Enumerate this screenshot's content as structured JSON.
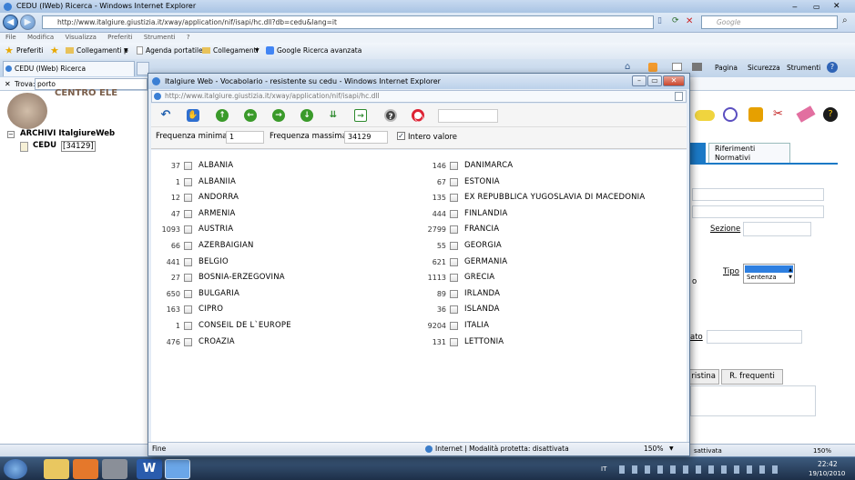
{
  "main_window": {
    "title": "CEDU (IWeb) Ricerca - Windows Internet Explorer",
    "url": "http://www.italgiure.giustizia.it/xway/application/nif/isapi/hc.dll?db=cedu&lang=it",
    "search_placeholder": "Google",
    "menu": [
      "File",
      "Modifica",
      "Visualizza",
      "Preferiti",
      "Strumenti",
      "?"
    ],
    "favorites": {
      "preferiti": "Preferiti",
      "items": [
        "Collegamenti p",
        "Agenda portatile",
        "Collegamenti",
        "Google Ricerca avanzata"
      ]
    },
    "tab_label": "CEDU (IWeb) Ricerca",
    "command_bar": [
      "Pagina",
      "Sicurezza",
      "Strumenti"
    ],
    "find": {
      "label": "Trova:",
      "value": "porto"
    },
    "tree": {
      "root": "ARCHIVI ItalgiureWeb",
      "child": "CEDU",
      "child_count": "[34129]"
    },
    "partial_header_text": "CENTRO ELE",
    "right_panel": {
      "tab_riferimenti": "Riferimenti Normativi",
      "sezione_label": "Sezione",
      "tipo_label": "Tipo",
      "tipo_option": "Sentenza",
      "fragment_o": "o",
      "fragment_ato": "ato",
      "btn_ristina": "ristina",
      "btn_rfrequenti": "R. frequenti"
    },
    "status": {
      "text": "sattivata",
      "zoom": "150%"
    }
  },
  "popup": {
    "title": "Italgiure Web - Vocabolario - resistente su cedu - Windows Internet Explorer",
    "url": "http://www.italgiure.giustizia.it/xway/application/nif/isapi/hc.dll",
    "filter": {
      "freq_min_label": "Frequenza minima",
      "freq_min_value": "1",
      "freq_max_label": "Frequenza massima",
      "freq_max_value": "34129",
      "intero_label": "Intero valore"
    },
    "left_column": [
      {
        "count": "37",
        "term": "ALBANIA"
      },
      {
        "count": "1",
        "term": "ALBANIIA"
      },
      {
        "count": "12",
        "term": "ANDORRA"
      },
      {
        "count": "47",
        "term": "ARMENIA"
      },
      {
        "count": "1093",
        "term": "AUSTRIA"
      },
      {
        "count": "66",
        "term": "AZERBAIGIAN"
      },
      {
        "count": "441",
        "term": "BELGIO"
      },
      {
        "count": "27",
        "term": "BOSNIA-ERZEGOVINA"
      },
      {
        "count": "650",
        "term": "BULGARIA"
      },
      {
        "count": "163",
        "term": "CIPRO"
      },
      {
        "count": "1",
        "term": "CONSEIL DE L`EUROPE"
      },
      {
        "count": "476",
        "term": "CROAZIA"
      }
    ],
    "right_column": [
      {
        "count": "146",
        "term": "DANIMARCA"
      },
      {
        "count": "67",
        "term": "ESTONIA"
      },
      {
        "count": "135",
        "term": "EX REPUBBLICA YUGOSLAVIA DI MACEDONIA"
      },
      {
        "count": "444",
        "term": "FINLANDIA"
      },
      {
        "count": "2799",
        "term": "FRANCIA"
      },
      {
        "count": "55",
        "term": "GEORGIA"
      },
      {
        "count": "621",
        "term": "GERMANIA"
      },
      {
        "count": "1113",
        "term": "GRECIA"
      },
      {
        "count": "89",
        "term": "IRLANDA"
      },
      {
        "count": "36",
        "term": "ISLANDA"
      },
      {
        "count": "9204",
        "term": "ITALIA"
      },
      {
        "count": "131",
        "term": "LETTONIA"
      }
    ],
    "status": {
      "left": "Fine",
      "zone": "Internet | Modalità protetta: disattivata",
      "zoom": "150%"
    }
  },
  "taskbar": {
    "lang": "IT",
    "time": "22:42",
    "date": "19/10/2010"
  },
  "colors": {
    "titlebar": "#bcd1ea",
    "accent_blue": "#1f5fae",
    "green_btn": "#3a9a2a"
  }
}
